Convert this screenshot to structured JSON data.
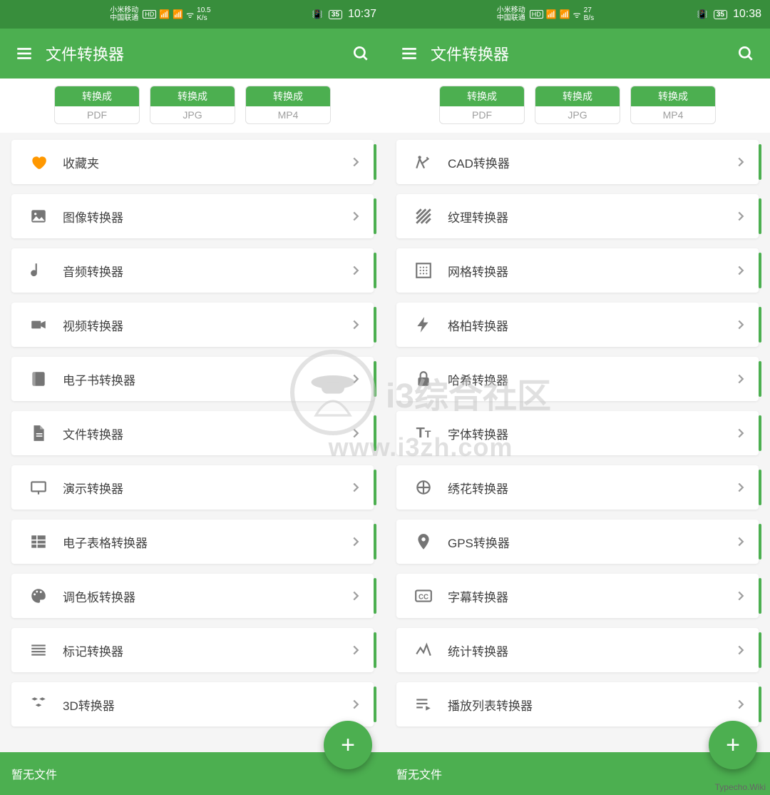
{
  "watermark": {
    "brand": "i3综合社区",
    "url": "www.i3zh.com"
  },
  "corner": "Typecho.Wiki",
  "left": {
    "status": {
      "carrier_top": "小米移动",
      "carrier_bot": "中国联通",
      "hd": "HD",
      "net46": "46",
      "speed": "10.5",
      "speed_unit": "K/s",
      "battery": "35",
      "clock": "10:37"
    },
    "title": "文件转换器",
    "chips": [
      {
        "top": "转换成",
        "bot": "PDF"
      },
      {
        "top": "转换成",
        "bot": "JPG"
      },
      {
        "top": "转换成",
        "bot": "MP4"
      }
    ],
    "items": [
      {
        "label": "收藏夹",
        "icon": "heart",
        "orange": true
      },
      {
        "label": "图像转换器",
        "icon": "image"
      },
      {
        "label": "音频转换器",
        "icon": "note"
      },
      {
        "label": "视频转换器",
        "icon": "video"
      },
      {
        "label": "电子书转换器",
        "icon": "book"
      },
      {
        "label": "文件转换器",
        "icon": "file"
      },
      {
        "label": "演示转换器",
        "icon": "presentation"
      },
      {
        "label": "电子表格转换器",
        "icon": "grid"
      },
      {
        "label": "调色板转换器",
        "icon": "palette"
      },
      {
        "label": "标记转换器",
        "icon": "lines"
      },
      {
        "label": "3D转换器",
        "icon": "cubes"
      }
    ],
    "footer": "暂无文件"
  },
  "right": {
    "status": {
      "carrier_top": "小米移动",
      "carrier_bot": "中国联通",
      "hd": "HD",
      "net46": "46",
      "speed": "27",
      "speed_unit": "B/s",
      "battery": "35",
      "clock": "10:38"
    },
    "title": "文件转换器",
    "chips": [
      {
        "top": "转换成",
        "bot": "PDF"
      },
      {
        "top": "转换成",
        "bot": "JPG"
      },
      {
        "top": "转换成",
        "bot": "MP4"
      }
    ],
    "items": [
      {
        "label": "CAD转换器",
        "icon": "compass"
      },
      {
        "label": "纹理转换器",
        "icon": "hatch"
      },
      {
        "label": "网格转换器",
        "icon": "dotgrid"
      },
      {
        "label": "格柏转换器",
        "icon": "bolt"
      },
      {
        "label": "哈希转换器",
        "icon": "lock"
      },
      {
        "label": "字体转换器",
        "icon": "tt"
      },
      {
        "label": "绣花转换器",
        "icon": "circle"
      },
      {
        "label": "GPS转换器",
        "icon": "pin"
      },
      {
        "label": "字幕转换器",
        "icon": "cc"
      },
      {
        "label": "统计转换器",
        "icon": "spark"
      },
      {
        "label": "播放列表转换器",
        "icon": "playlist"
      }
    ],
    "footer": "暂无文件"
  }
}
